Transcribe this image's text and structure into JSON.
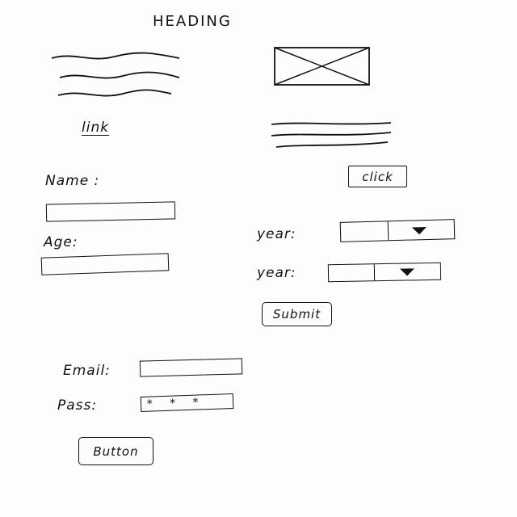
{
  "header": {
    "title": "HEADING"
  },
  "left_column": {
    "link_label": "link"
  },
  "right_column": {
    "click_label": "click"
  },
  "form_a": {
    "name_label": "Name :",
    "age_label": "Age:"
  },
  "form_b": {
    "year_label_1": "year:",
    "year_label_2": "year:",
    "submit_label": "Submit"
  },
  "form_c": {
    "email_label": "Email:",
    "pass_label": "Pass:",
    "pass_value": "***",
    "button_label": "Button"
  },
  "icons": {
    "image_placeholder": "image-placeholder-icon",
    "dropdown": "caret-down-icon"
  }
}
